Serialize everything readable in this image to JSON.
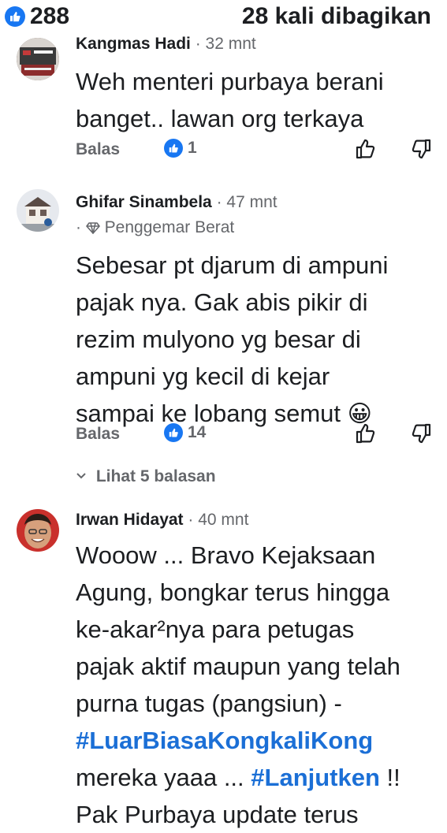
{
  "header": {
    "reaction_count": "288",
    "shares_text": "28 kali dibagikan"
  },
  "comments": [
    {
      "author": "Kangmas Hadi",
      "time": "32 mnt",
      "text_lines": [
        "Weh menteri purbaya  berani",
        "banget.. lawan org terkaya"
      ],
      "reply_label": "Balas",
      "reaction_count": "1"
    },
    {
      "author": "Ghifar Sinambela",
      "time": "47 mnt",
      "badge": "Penggemar Berat",
      "text_lines": [
        "Sebesar pt djarum di ampuni",
        "pajak nya. Gak abis pikir di",
        "rezim mulyono yg besar di",
        "ampuni yg kecil di kejar",
        "sampai ke lobang semut"
      ],
      "emoji": "😀",
      "reply_label": "Balas",
      "reaction_count": "14",
      "view_replies": "Lihat 5 balasan"
    },
    {
      "author": "Irwan Hidayat",
      "time": "40 mnt",
      "text_lines": [
        "Wooow ... Bravo Kejaksaan",
        "Agung, bongkar terus hingga",
        "ke-akar²nya para petugas",
        "pajak aktif maupun yang telah",
        "purna tugas (pangsiun) -"
      ],
      "hashtag1": "#LuarBiasaKongkaliKong",
      "line7_prefix": "mereka yaaa ... ",
      "hashtag2": "#Lanjutken",
      "line7_suffix": " !!",
      "line8": "Pak Purbaya update terus"
    }
  ],
  "colors": {
    "accent": "#1877f2",
    "hashtag": "#1b6fd6",
    "muted": "#65676b",
    "text": "#1c1e21"
  },
  "icons": [
    "like-icon",
    "thumbs-up-icon",
    "thumbs-down-icon",
    "diamond-icon",
    "chevron-down-icon"
  ]
}
